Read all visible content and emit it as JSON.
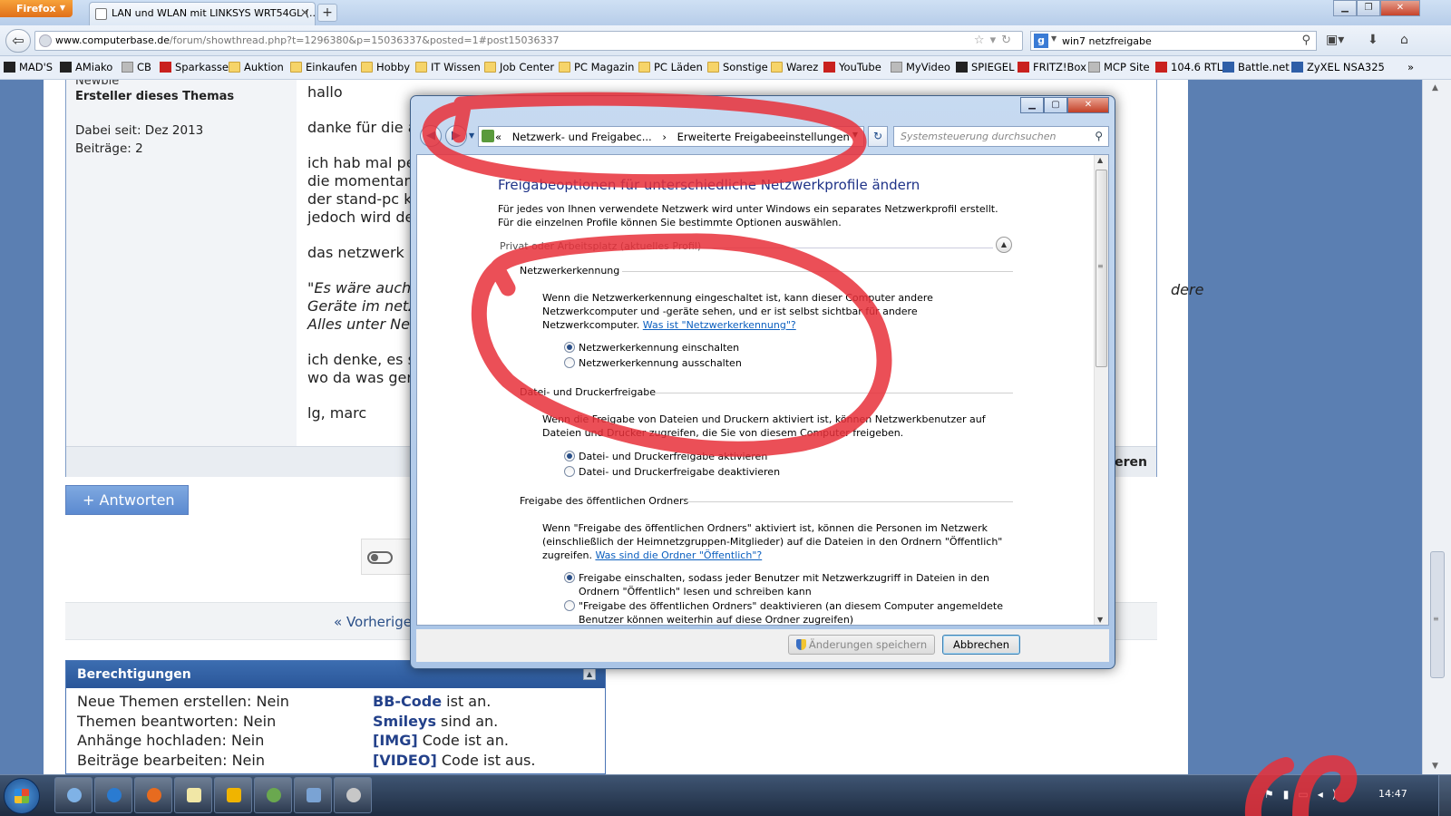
{
  "browser": {
    "menu_button": "Firefox",
    "tab_title": "LAN und WLAN mit LINKSYS WRT54GL (...",
    "url_host": "www.computerbase.de",
    "url_path": "/forum/showthread.php?t=1296380&p=15036337&posted=1#post15036337",
    "search_query": "win7 netzfreigabe"
  },
  "bookmarks": [
    {
      "label": "MAD'S",
      "icon": "fire-icon"
    },
    {
      "label": "AMiako",
      "icon": "m-icon"
    },
    {
      "label": "CB",
      "icon": "cb-icon"
    },
    {
      "label": "Sparkasse",
      "icon": "sparkasse-icon"
    },
    {
      "label": "Auktion",
      "icon": "folder-icon"
    },
    {
      "label": "Einkaufen",
      "icon": "folder-icon"
    },
    {
      "label": "Hobby",
      "icon": "folder-icon"
    },
    {
      "label": "IT Wissen",
      "icon": "folder-icon"
    },
    {
      "label": "Job Center",
      "icon": "folder-icon"
    },
    {
      "label": "PC Magazin",
      "icon": "folder-icon"
    },
    {
      "label": "PC Läden",
      "icon": "folder-icon"
    },
    {
      "label": "Sonstige",
      "icon": "folder-icon"
    },
    {
      "label": "Warez",
      "icon": "folder-icon"
    },
    {
      "label": "YouTube",
      "icon": "youtube-icon"
    },
    {
      "label": "MyVideo",
      "icon": "myvideo-icon"
    },
    {
      "label": "SPIEGEL",
      "icon": "spiegel-icon"
    },
    {
      "label": "FRITZ!Box",
      "icon": "fritzbox-icon"
    },
    {
      "label": "MCP Site",
      "icon": "page-icon"
    },
    {
      "label": "104.6 RTL",
      "icon": "radio-icon"
    },
    {
      "label": "Battle.net",
      "icon": "battlenet-icon"
    },
    {
      "label": "ZyXEL NSA325",
      "icon": "zyxel-icon"
    }
  ],
  "forum": {
    "author_rank": "Newbie",
    "author_role": "Ersteller dieses Themas",
    "joined": "Dabei seit: Dez 2013",
    "posts": "Beiträge: 2",
    "post_lines": {
      "p1": "hallo",
      "p2": "danke für die a",
      "p3a": "ich hab mal pe",
      "p3b": "die momentan",
      "p3c": "der stand-pc k",
      "p3d": "jedoch wird de",
      "p4": "das netzwerk i",
      "p5a": "\"Es wäre auch",
      "p5b": "Geräte im netz",
      "p5c": "Alles unter Ne",
      "p5_right": "dere",
      "p6a": "ich denke, es s",
      "p6b": "wo da was ger",
      "p7": "lg, marc"
    },
    "footer_right": "eren",
    "reply_button": "+ Antworten",
    "pager_prev": "« Vorherige"
  },
  "permissions": {
    "title": "Berechtigungen",
    "left": [
      "Neue Themen erstellen: Nein",
      "Themen beantworten: Nein",
      "Anhänge hochladen: Nein",
      "Beiträge bearbeiten: Nein"
    ],
    "right": [
      {
        "code": "BB-Code",
        "rest": " ist an."
      },
      {
        "code": "Smileys",
        "rest": " sind an."
      },
      {
        "code": "[IMG]",
        "rest": " Code ist an."
      },
      {
        "code": "[VIDEO]",
        "rest": " Code ist aus."
      }
    ]
  },
  "dialog": {
    "breadcrumb": [
      "«",
      "Netzwerk- und Freigabec...",
      "›",
      "Erweiterte Freigabeeinstellungen"
    ],
    "search_placeholder": "Systemsteuerung durchsuchen",
    "title": "Freigabeoptionen für unterschiedliche Netzwerkprofile ändern",
    "intro": "Für jedes von Ihnen verwendete Netzwerk wird unter Windows ein separates Netzwerkprofil erstellt. Für die einzelnen Profile können Sie bestimmte Optionen auswählen.",
    "profile_header": "Privat oder Arbeitsplatz (aktuelles Profil)",
    "sections": {
      "discovery": {
        "heading": "Netzwerkerkennung",
        "text": "Wenn die Netzwerkerkennung eingeschaltet ist, kann dieser Computer andere Netzwerkcomputer und -geräte sehen, und er ist selbst sichtbar für andere Netzwerkcomputer. ",
        "link": "Was ist \"Netzwerkerkennung\"?",
        "option_on": "Netzwerkerkennung einschalten",
        "option_off": "Netzwerkerkennung ausschalten"
      },
      "fileprint": {
        "heading": "Datei- und Druckerfreigabe",
        "text": "Wenn die Freigabe von Dateien und Druckern aktiviert ist, können Netzwerkbenutzer auf Dateien und Drucker zugreifen, die Sie von diesem Computer freigeben.",
        "option_on": "Datei- und Druckerfreigabe aktivieren",
        "option_off": "Datei- und Druckerfreigabe deaktivieren"
      },
      "public": {
        "heading": "Freigabe des öffentlichen Ordners",
        "text": "Wenn \"Freigabe des öffentlichen Ordners\" aktiviert ist, können die Personen im Netzwerk (einschließlich der Heimnetzgruppen-Mitglieder) auf die Dateien in den Ordnern \"Öffentlich\" zugreifen. ",
        "link": "Was sind die Ordner \"Öffentlich\"?",
        "option_on": "Freigabe einschalten, sodass jeder Benutzer mit Netzwerkzugriff in Dateien in den Ordnern \"Öffentlich\" lesen und schreiben kann",
        "option_off": "\"Freigabe des öffentlichen Ordners\" deaktivieren (an diesem Computer angemeldete Benutzer können weiterhin auf diese Ordner zugreifen)"
      }
    },
    "save_button": "Änderungen speichern",
    "cancel_button": "Abbrechen"
  },
  "taskbar": {
    "clock": "14:47"
  },
  "colors": {
    "annotation_red": "#e8303a",
    "forum_blue": "#2a5699",
    "dialog_title_blue": "#1e3287"
  }
}
